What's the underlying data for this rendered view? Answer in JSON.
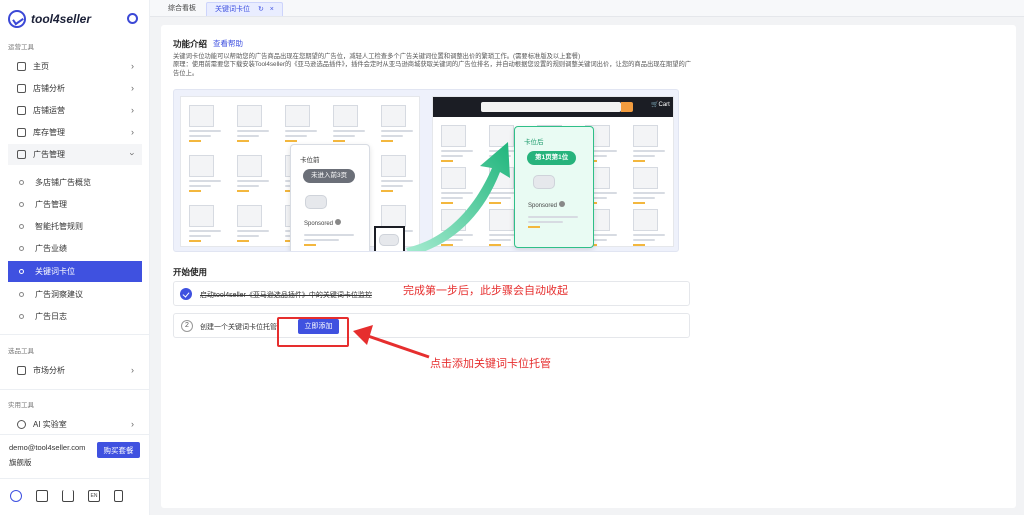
{
  "brand": {
    "name": "tool4seller"
  },
  "sidebar": {
    "section_ops": "运营工具",
    "section_select": "选品工具",
    "section_util": "实用工具",
    "items": [
      {
        "label": "主页",
        "icon": "home-icon"
      },
      {
        "label": "店铺分析",
        "icon": "chart-icon"
      },
      {
        "label": "店铺运营",
        "icon": "store-icon"
      },
      {
        "label": "库存管理",
        "icon": "warehouse-icon"
      },
      {
        "label": "广告管理",
        "icon": "monitor-icon"
      }
    ],
    "sub_items": [
      {
        "label": "多店铺广告概览"
      },
      {
        "label": "广告管理"
      },
      {
        "label": "智能托管规则"
      },
      {
        "label": "广告业绩"
      },
      {
        "label": "关键词卡位"
      },
      {
        "label": "广告洞察建议"
      },
      {
        "label": "广告日志"
      }
    ],
    "market": {
      "label": "市场分析",
      "icon": "market-icon"
    },
    "ai": {
      "label": "AI 实验室",
      "icon": "ai-icon"
    },
    "email": "demo@tool4seller.com",
    "plan": "旗舰版",
    "buy_label": "购买套餐",
    "lang_label": "EN"
  },
  "tabs": [
    {
      "label": "综合看板"
    },
    {
      "label": "关键词卡位"
    }
  ],
  "main": {
    "intro_title": "功能介绍",
    "intro_link": "查看帮助",
    "desc1": "关键词卡位功能可以帮助您的广告商品出现在您期望的广告位，减轻人工检查多个广告关键词位置和调整出价的繁琐工作。(需要标准版及以上套餐)",
    "desc2": "原理：使用前需要您下载安装Tool4seller的《亚马逊选品插件》，插件会定时从亚马逊商城获取关键词的广告位排名，并自动根据您设置的规则调整关键词出价，让您的商品出现在期望的广告位上。",
    "before_title": "卡位前",
    "before_pill": "未进入前3页",
    "after_title": "卡位后",
    "after_pill": "第1页第1位",
    "sponsored": "Sponsored",
    "cart": "Cart",
    "start_title": "开始使用",
    "step1": "启动tool4seller《亚马逊选品插件》中的关键词卡位监控",
    "step2_num": "2",
    "step2": "创建一个关键词卡位托管",
    "add_label": "立即添加",
    "note1": "完成第一步后，此步骤会自动收起",
    "note2": "点击添加关键词卡位托管"
  },
  "colors": {
    "primary": "#3f51e0",
    "annotation": "#e62e2e",
    "success": "#27b37c"
  }
}
